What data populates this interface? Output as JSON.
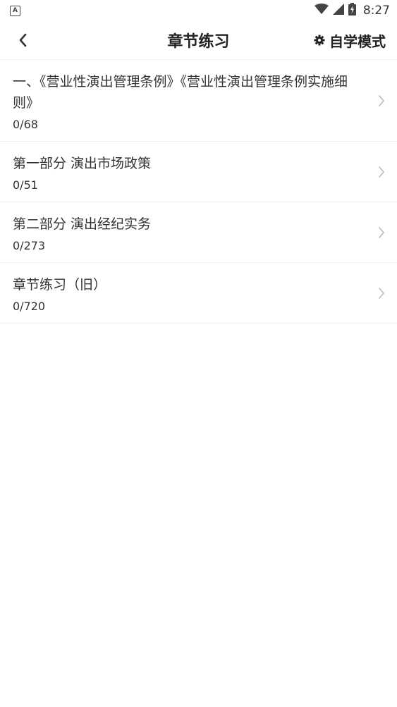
{
  "status_bar": {
    "app_badge": "A",
    "time": "8:27"
  },
  "header": {
    "title": "章节练习",
    "mode_label": "自学模式",
    "back_icon": "chevron-left-icon",
    "mode_icon": "gear-icon"
  },
  "chapters": [
    {
      "title": "一、《营业性演出管理条例》《营业性演出管理条例实施细则》",
      "progress": "0/68"
    },
    {
      "title": "第一部分 演出市场政策",
      "progress": "0/51"
    },
    {
      "title": "第二部分 演出经纪实务",
      "progress": "0/273"
    },
    {
      "title": "章节练习（旧）",
      "progress": "0/720"
    }
  ],
  "colors": {
    "text": "#333333",
    "divider": "#efefef",
    "chevron": "#bbbbbb"
  }
}
